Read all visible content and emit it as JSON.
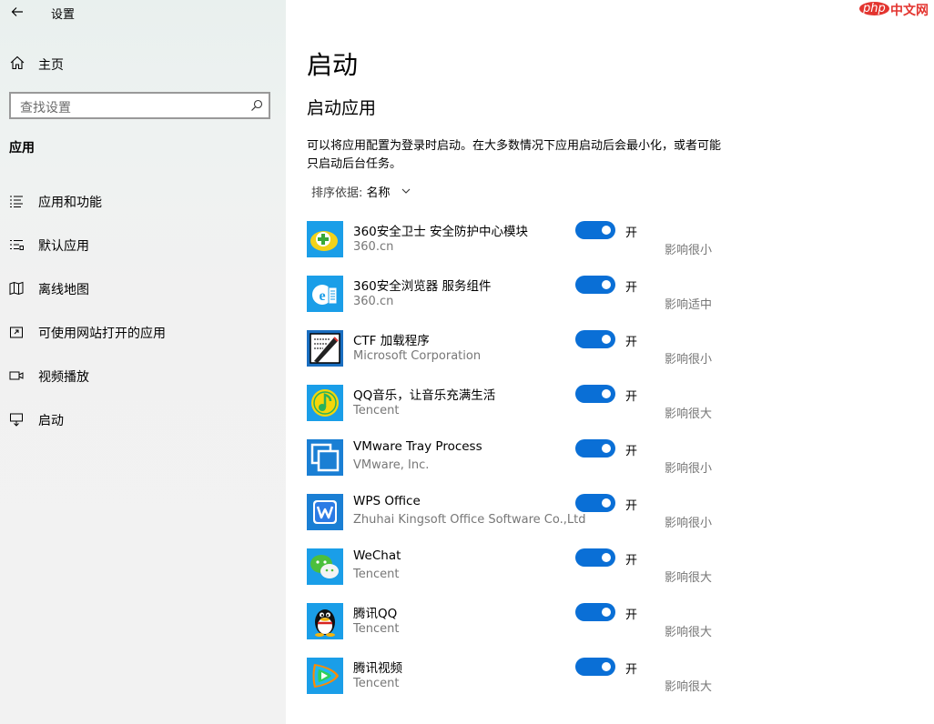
{
  "window": {
    "title": "设置"
  },
  "watermark": {
    "logo": "php",
    "text": "中文网"
  },
  "sidebar": {
    "home": "主页",
    "search_placeholder": "查找设置",
    "section": "应用",
    "items": [
      {
        "label": "应用和功能",
        "icon": "apps-list-icon"
      },
      {
        "label": "默认应用",
        "icon": "default-apps-icon"
      },
      {
        "label": "离线地图",
        "icon": "map-icon"
      },
      {
        "label": "可使用网站打开的应用",
        "icon": "web-open-icon"
      },
      {
        "label": "视频播放",
        "icon": "video-icon"
      },
      {
        "label": "启动",
        "icon": "startup-icon"
      }
    ]
  },
  "main": {
    "title": "启动",
    "section_title": "启动应用",
    "description": "可以将应用配置为登录时启动。在大多数情况下应用启动后会最小化，或者可能只启动后台任务。",
    "sort_label": "排序依据:",
    "sort_value": "名称",
    "apps": [
      {
        "name": "360安全卫士 安全防护中心模块",
        "publisher": "360.cn",
        "state": "开",
        "impact": "影响很小",
        "icon": "360-safe-icon",
        "enabled": true
      },
      {
        "name": "360安全浏览器 服务组件",
        "publisher": "360.cn",
        "state": "开",
        "impact": "影响适中",
        "icon": "360-browser-icon",
        "enabled": true
      },
      {
        "name": "CTF 加载程序",
        "publisher": "Microsoft Corporation",
        "state": "开",
        "impact": "影响很小",
        "icon": "ctf-loader-icon",
        "enabled": true
      },
      {
        "name": "QQ音乐，让音乐充满生活",
        "publisher": "Tencent",
        "state": "开",
        "impact": "影响很大",
        "icon": "qq-music-icon",
        "enabled": true
      },
      {
        "name": "VMware Tray Process",
        "publisher": "VMware, Inc.",
        "state": "开",
        "impact": "影响很小",
        "icon": "vmware-icon",
        "enabled": true
      },
      {
        "name": "WPS Office",
        "publisher": "Zhuhai Kingsoft Office Software Co.,Ltd",
        "state": "开",
        "impact": "影响很小",
        "icon": "wps-icon",
        "enabled": true
      },
      {
        "name": "WeChat",
        "publisher": "Tencent",
        "state": "开",
        "impact": "影响很大",
        "icon": "wechat-icon",
        "enabled": true
      },
      {
        "name": "腾讯QQ",
        "publisher": "Tencent",
        "state": "开",
        "impact": "影响很大",
        "icon": "qq-icon",
        "enabled": true
      },
      {
        "name": "腾讯视频",
        "publisher": "Tencent",
        "state": "开",
        "impact": "影响很大",
        "icon": "tencent-video-icon",
        "enabled": true
      }
    ]
  },
  "colors": {
    "accent": "#0a6fd6"
  }
}
